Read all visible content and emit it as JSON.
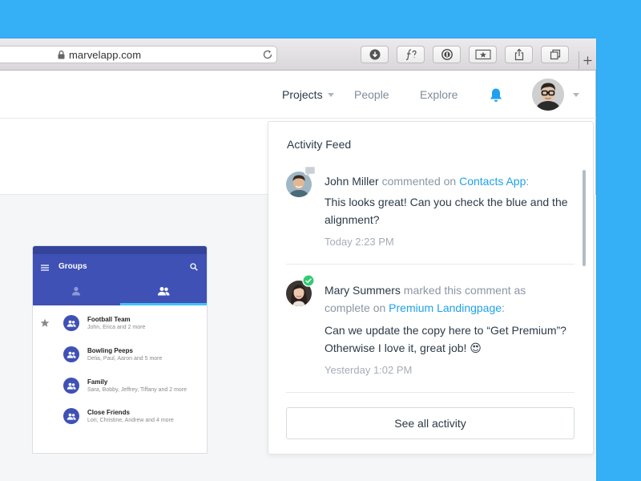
{
  "browser": {
    "url": "marvelapp.com",
    "toolbar_buttons": [
      "download-icon",
      "function-icon",
      "password-icon",
      "bookmark-icon",
      "share-icon",
      "tabs-icon"
    ]
  },
  "nav": {
    "projects": "Projects",
    "people": "People",
    "explore": "Explore"
  },
  "phone": {
    "title": "Groups",
    "groups": [
      {
        "name": "Football Team",
        "members": "John, Erica and 2 more",
        "starred": true
      },
      {
        "name": "Bowling Peeps",
        "members": "Delia, Paul, Aaron and 5 more",
        "starred": false
      },
      {
        "name": "Family",
        "members": "Sara, Bobby, Jeffrey, Tiffany and 2 more",
        "starred": false
      },
      {
        "name": "Close Friends",
        "members": "Lori, Christine, Andrew and 4 more",
        "starred": false
      }
    ]
  },
  "feed": {
    "title": "Activity Feed",
    "items": [
      {
        "user": "John Miller",
        "action": "commented on",
        "target": "Contacts App",
        "suffix": ":",
        "message": "This looks great! Can you check the blue and the alignment?",
        "time": "Today 2:23 PM"
      },
      {
        "user": "Mary Summers",
        "action": "marked this comment as complete on",
        "target": "Premium Landingpage",
        "suffix": ":",
        "message": "Can we update the copy here to “Get Premium”? Otherwise I love it, great job! 😍",
        "time": "Yesterday 1:02 PM"
      }
    ],
    "see_all": "See all activity"
  },
  "colors": {
    "desktop": "#35b0f6",
    "link": "#1fa1ec",
    "phone_primary": "#3f51b5",
    "complete_badge": "#2ecc71"
  }
}
